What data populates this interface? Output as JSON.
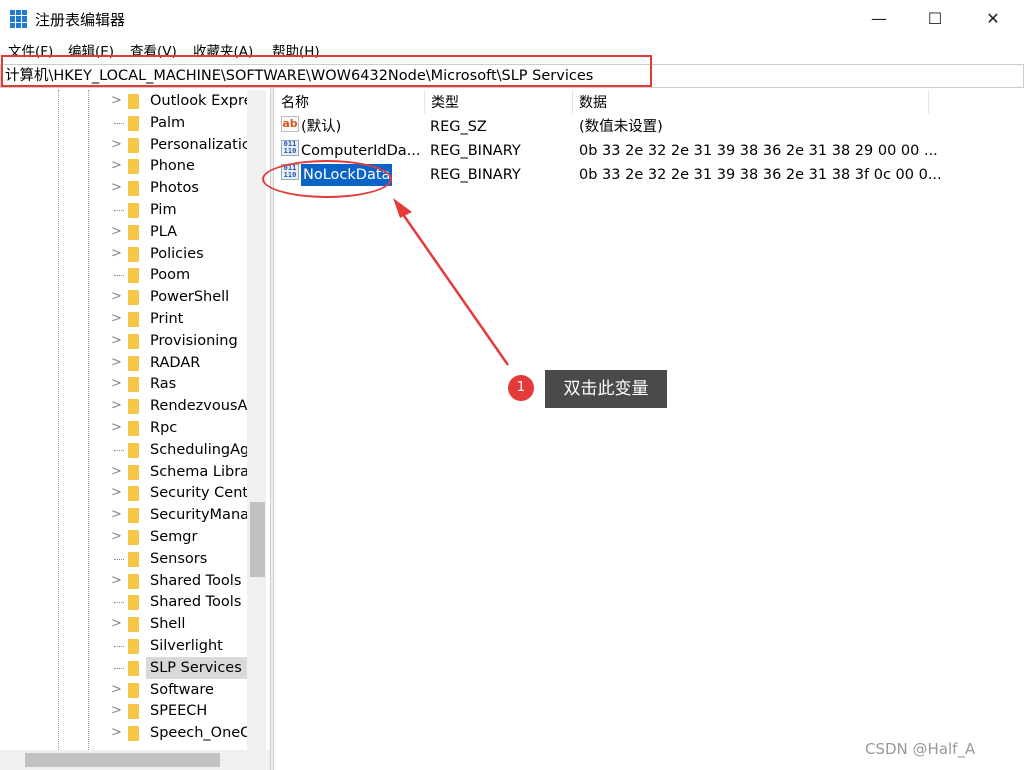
{
  "window": {
    "title": "注册表编辑器",
    "minimize": "—",
    "maximize": "☐",
    "close": "✕"
  },
  "menu": [
    "文件(F)",
    "编辑(E)",
    "查看(V)",
    "收藏夹(A)",
    "帮助(H)"
  ],
  "address": "计算机\\HKEY_LOCAL_MACHINE\\SOFTWARE\\WOW6432Node\\Microsoft\\SLP Services",
  "tree": [
    {
      "label": "Outlook Expre",
      "exp": true
    },
    {
      "label": "Palm",
      "exp": false
    },
    {
      "label": "Personalizatic",
      "exp": true
    },
    {
      "label": "Phone",
      "exp": true
    },
    {
      "label": "Photos",
      "exp": true
    },
    {
      "label": "Pim",
      "exp": false
    },
    {
      "label": "PLA",
      "exp": true
    },
    {
      "label": "Policies",
      "exp": true
    },
    {
      "label": "Poom",
      "exp": false
    },
    {
      "label": "PowerShell",
      "exp": true
    },
    {
      "label": "Print",
      "exp": true
    },
    {
      "label": "Provisioning",
      "exp": true
    },
    {
      "label": "RADAR",
      "exp": true
    },
    {
      "label": "Ras",
      "exp": true
    },
    {
      "label": "RendezvousA",
      "exp": true
    },
    {
      "label": "Rpc",
      "exp": true
    },
    {
      "label": "SchedulingAg",
      "exp": false
    },
    {
      "label": "Schema Libra",
      "exp": true
    },
    {
      "label": "Security Cent",
      "exp": true
    },
    {
      "label": "SecurityMana",
      "exp": true
    },
    {
      "label": "Semgr",
      "exp": true
    },
    {
      "label": "Sensors",
      "exp": false
    },
    {
      "label": "Shared Tools",
      "exp": true
    },
    {
      "label": "Shared Tools",
      "exp": false
    },
    {
      "label": "Shell",
      "exp": true
    },
    {
      "label": "Silverlight",
      "exp": false
    },
    {
      "label": "SLP Services",
      "exp": false,
      "selected": true
    },
    {
      "label": "Software",
      "exp": true
    },
    {
      "label": "SPEECH",
      "exp": true
    },
    {
      "label": "Speech_OneC",
      "exp": true
    }
  ],
  "columns": {
    "name": "名称",
    "type": "类型",
    "data": "数据"
  },
  "values": [
    {
      "icon": "ab",
      "name": "(默认)",
      "type": "REG_SZ",
      "data": "(数值未设置)"
    },
    {
      "icon": "bin",
      "name": "ComputerIdDa...",
      "type": "REG_BINARY",
      "data": "0b 33 2e 32 2e 31 39 38 36 2e 31 38 29 00 00 ..."
    },
    {
      "icon": "bin",
      "name": "NoLockData",
      "type": "REG_BINARY",
      "data": "0b 33 2e 32 2e 31 39 38 36 2e 31 38 3f 0c 00 0...",
      "selected": true
    }
  ],
  "annotation": {
    "step": "1",
    "text": "双击此变量"
  },
  "watermark": "CSDN @Half_A"
}
